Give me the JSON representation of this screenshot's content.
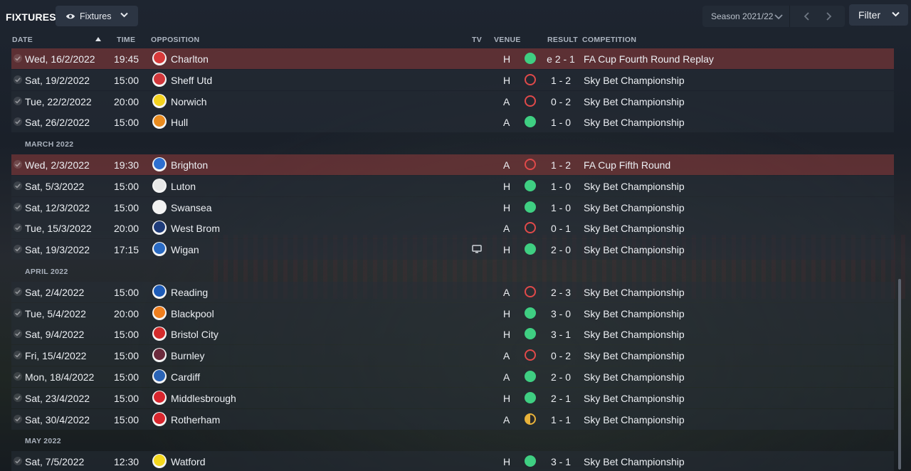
{
  "header": {
    "title": "FIXTURES",
    "view_label": "Fixtures",
    "season_label": "Season 2021/22",
    "filter_label": "Filter"
  },
  "columns": {
    "date": "DATE",
    "time": "TIME",
    "opposition": "OPPOSITION",
    "tv": "TV",
    "venue": "VENUE",
    "result": "RESULT",
    "competition": "COMPETITION"
  },
  "colors": {
    "win": "#3fcf82",
    "loss": "#e04a4a",
    "draw": "#e8b23a",
    "cup_row": "#8c3a3a"
  },
  "list": [
    {
      "kind": "fixture",
      "cup": true,
      "date": "Wed, 16/2/2022",
      "time": "19:45",
      "opponent": "Charlton",
      "crest_color": "#d83a3a",
      "tv": false,
      "venue": "H",
      "outcome": "win",
      "result": "e 2 - 1",
      "competition": "FA Cup Fourth Round Replay"
    },
    {
      "kind": "fixture",
      "cup": false,
      "date": "Sat, 19/2/2022",
      "time": "15:00",
      "opponent": "Sheff Utd",
      "crest_color": "#d1373b",
      "tv": false,
      "venue": "H",
      "outcome": "loss",
      "result": "1 - 2",
      "competition": "Sky Bet Championship"
    },
    {
      "kind": "fixture",
      "cup": false,
      "date": "Tue, 22/2/2022",
      "time": "20:00",
      "opponent": "Norwich",
      "crest_color": "#f4d21f",
      "tv": false,
      "venue": "A",
      "outcome": "loss",
      "result": "0 - 2",
      "competition": "Sky Bet Championship"
    },
    {
      "kind": "fixture",
      "cup": false,
      "date": "Sat, 26/2/2022",
      "time": "15:00",
      "opponent": "Hull",
      "crest_color": "#e98b1f",
      "tv": false,
      "venue": "A",
      "outcome": "win",
      "result": "1 - 0",
      "competition": "Sky Bet Championship"
    },
    {
      "kind": "month",
      "label": "MARCH 2022"
    },
    {
      "kind": "fixture",
      "cup": true,
      "date": "Wed, 2/3/2022",
      "time": "19:30",
      "opponent": "Brighton",
      "crest_color": "#2e6fd0",
      "tv": false,
      "venue": "A",
      "outcome": "loss",
      "result": "1 - 2",
      "competition": "FA Cup Fifth Round"
    },
    {
      "kind": "fixture",
      "cup": false,
      "date": "Sat, 5/3/2022",
      "time": "15:00",
      "opponent": "Luton",
      "crest_color": "#e8e8e8",
      "tv": false,
      "venue": "H",
      "outcome": "win",
      "result": "1 - 0",
      "competition": "Sky Bet Championship"
    },
    {
      "kind": "fixture",
      "cup": false,
      "date": "Sat, 12/3/2022",
      "time": "15:00",
      "opponent": "Swansea",
      "crest_color": "#f2f2f2",
      "tv": false,
      "venue": "H",
      "outcome": "win",
      "result": "1 - 0",
      "competition": "Sky Bet Championship"
    },
    {
      "kind": "fixture",
      "cup": false,
      "date": "Tue, 15/3/2022",
      "time": "20:00",
      "opponent": "West Brom",
      "crest_color": "#1f3c7a",
      "tv": false,
      "venue": "A",
      "outcome": "loss",
      "result": "0 - 1",
      "competition": "Sky Bet Championship"
    },
    {
      "kind": "fixture",
      "cup": false,
      "date": "Sat, 19/3/2022",
      "time": "17:15",
      "opponent": "Wigan",
      "crest_color": "#2a6ac2",
      "tv": true,
      "venue": "H",
      "outcome": "win",
      "result": "2 - 0",
      "competition": "Sky Bet Championship"
    },
    {
      "kind": "month",
      "label": "APRIL 2022"
    },
    {
      "kind": "fixture",
      "cup": false,
      "date": "Sat, 2/4/2022",
      "time": "15:00",
      "opponent": "Reading",
      "crest_color": "#1e5cb8",
      "tv": false,
      "venue": "A",
      "outcome": "loss",
      "result": "2 - 3",
      "competition": "Sky Bet Championship"
    },
    {
      "kind": "fixture",
      "cup": false,
      "date": "Tue, 5/4/2022",
      "time": "20:00",
      "opponent": "Blackpool",
      "crest_color": "#f07f1e",
      "tv": false,
      "venue": "H",
      "outcome": "win",
      "result": "3 - 0",
      "competition": "Sky Bet Championship"
    },
    {
      "kind": "fixture",
      "cup": false,
      "date": "Sat, 9/4/2022",
      "time": "15:00",
      "opponent": "Bristol City",
      "crest_color": "#d42c2c",
      "tv": false,
      "venue": "H",
      "outcome": "win",
      "result": "3 - 1",
      "competition": "Sky Bet Championship"
    },
    {
      "kind": "fixture",
      "cup": false,
      "date": "Fri, 15/4/2022",
      "time": "15:00",
      "opponent": "Burnley",
      "crest_color": "#6b2a3c",
      "tv": false,
      "venue": "A",
      "outcome": "loss",
      "result": "0 - 2",
      "competition": "Sky Bet Championship"
    },
    {
      "kind": "fixture",
      "cup": false,
      "date": "Mon, 18/4/2022",
      "time": "15:00",
      "opponent": "Cardiff",
      "crest_color": "#2b64b6",
      "tv": false,
      "venue": "A",
      "outcome": "win",
      "result": "2 - 0",
      "competition": "Sky Bet Championship"
    },
    {
      "kind": "fixture",
      "cup": false,
      "date": "Sat, 23/4/2022",
      "time": "15:00",
      "opponent": "Middlesbrough",
      "crest_color": "#d8262e",
      "tv": false,
      "venue": "H",
      "outcome": "win",
      "result": "2 - 1",
      "competition": "Sky Bet Championship"
    },
    {
      "kind": "fixture",
      "cup": false,
      "date": "Sat, 30/4/2022",
      "time": "15:00",
      "opponent": "Rotherham",
      "crest_color": "#d8262e",
      "tv": false,
      "venue": "A",
      "outcome": "draw",
      "result": "1 - 1",
      "competition": "Sky Bet Championship"
    },
    {
      "kind": "month",
      "label": "MAY 2022"
    },
    {
      "kind": "fixture",
      "cup": false,
      "date": "Sat, 7/5/2022",
      "time": "12:30",
      "opponent": "Watford",
      "crest_color": "#f5d81e",
      "tv": false,
      "venue": "H",
      "outcome": "win",
      "result": "3 - 1",
      "competition": "Sky Bet Championship"
    }
  ]
}
